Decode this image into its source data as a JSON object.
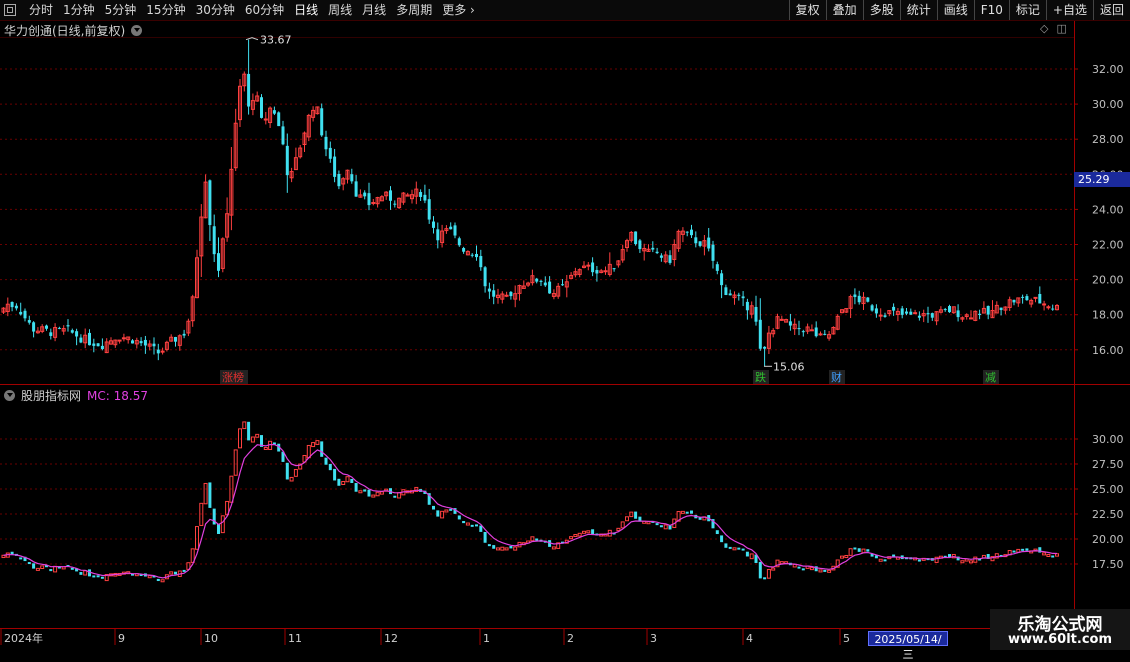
{
  "toolbar": {
    "periods": [
      "分时",
      "1分钟",
      "5分钟",
      "15分钟",
      "30分钟",
      "60分钟",
      "日线",
      "周线",
      "月线",
      "多周期",
      "更多"
    ],
    "active_period": "日线",
    "buttons": [
      "复权",
      "叠加",
      "多股",
      "统计",
      "画线",
      "F10",
      "标记",
      "+自选",
      "返回"
    ]
  },
  "main_panel": {
    "title": "华力创通(日线,前复权)",
    "high_label": "33.67",
    "low_label": "15.06",
    "current_price": "25.29",
    "y_ticks": [
      "32.00",
      "30.00",
      "28.00",
      "26.00",
      "24.00",
      "22.00",
      "20.00",
      "18.00",
      "16.00"
    ],
    "markers": [
      {
        "text": "涨榜",
        "color": "#e03030"
      },
      {
        "text": "跌",
        "color": "#30c030"
      },
      {
        "text": "财",
        "color": "#40a0ff"
      },
      {
        "text": "减",
        "color": "#30c030"
      }
    ]
  },
  "indicator_panel": {
    "title": "股朋指标网",
    "mc_label": "MC: 18.57",
    "y_ticks": [
      "30.00",
      "27.50",
      "25.00",
      "22.50",
      "20.00",
      "17.50"
    ]
  },
  "x_axis": {
    "labels": [
      "2024年",
      "9",
      "10",
      "11",
      "12",
      "1",
      "2",
      "3",
      "4",
      "5"
    ],
    "cursor_date": "2025/05/14/三"
  },
  "watermark": {
    "line1": "乐淘公式网",
    "line2": "www.60lt.com"
  },
  "colors": {
    "up": "#ff4040",
    "down": "#40e0f0",
    "mc_line": "#e040e0",
    "grid": "#6a0000",
    "axis": "#a00000"
  },
  "chart_data": {
    "type": "candlestick",
    "price_range": [
      15.06,
      33.67
    ],
    "x_month_labels": [
      "2024年",
      "9",
      "10",
      "11",
      "12",
      "1",
      "2",
      "3",
      "4",
      "5"
    ],
    "close_anchors": [
      {
        "month": "2024年",
        "value": 18.2
      },
      {
        "month": "9",
        "value": 17.0
      },
      {
        "month": "10",
        "value": 28.5
      },
      {
        "month": "11",
        "value": 26.5
      },
      {
        "month": "12",
        "value": 24.5
      },
      {
        "month": "1",
        "value": 19.0
      },
      {
        "month": "2",
        "value": 20.5
      },
      {
        "month": "3",
        "value": 21.8
      },
      {
        "month": "4",
        "value": 17.5
      },
      {
        "month": "5",
        "value": 18.6
      }
    ],
    "mc_last": 18.57
  }
}
